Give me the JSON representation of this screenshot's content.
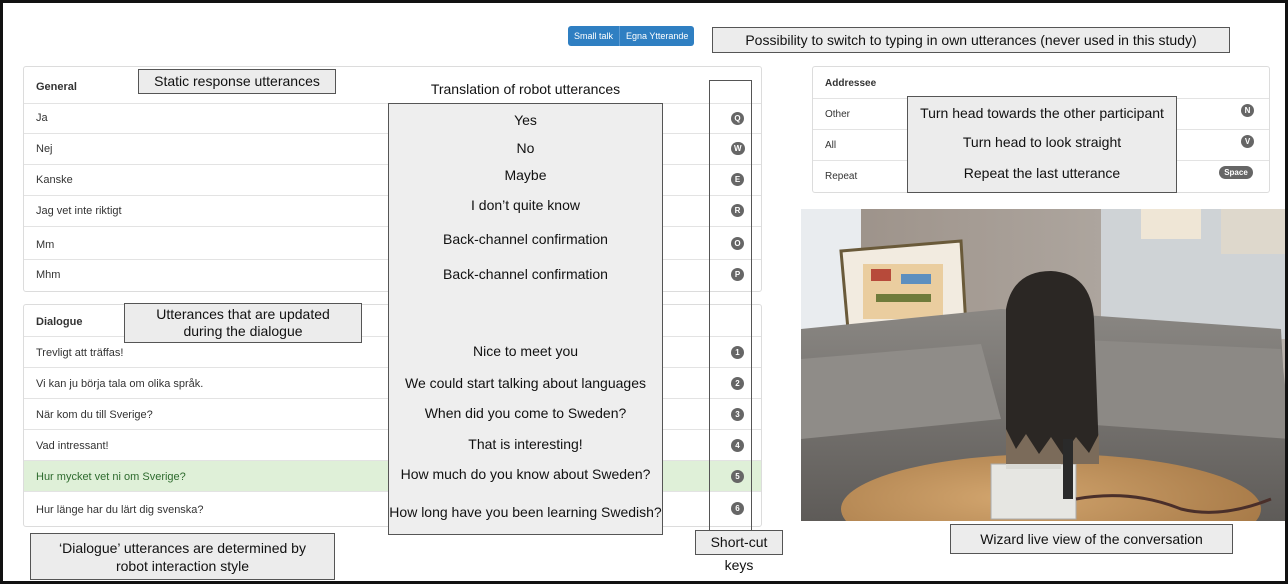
{
  "mode_buttons": {
    "small_talk": "Small talk",
    "own_utterances": "Egna Ytterande"
  },
  "general": {
    "header": "General",
    "rows": [
      {
        "label": "Ja",
        "key": "Q"
      },
      {
        "label": "Nej",
        "key": "W"
      },
      {
        "label": "Kanske",
        "key": "E"
      },
      {
        "label": "Jag vet inte riktigt",
        "key": "R"
      },
      {
        "label": "Mm",
        "key": "O"
      },
      {
        "label": "Mhm",
        "key": "P"
      }
    ]
  },
  "dialogue": {
    "header": "Dialogue",
    "rows": [
      {
        "label": "Trevligt att träffas!",
        "key": "1",
        "highlighted": false
      },
      {
        "label": "Vi kan ju börja tala om olika språk.",
        "key": "2",
        "highlighted": false
      },
      {
        "label": "När kom du till Sverige?",
        "key": "3",
        "highlighted": false
      },
      {
        "label": "Vad intressant!",
        "key": "4",
        "highlighted": false
      },
      {
        "label": "Hur mycket vet ni om Sverige?",
        "key": "5",
        "highlighted": true
      },
      {
        "label": "Hur länge har du lärt dig svenska?",
        "key": "6",
        "highlighted": false
      }
    ]
  },
  "addressee": {
    "header": "Addressee",
    "rows": [
      {
        "label": "Other",
        "key": "N"
      },
      {
        "label": "All",
        "key": "V"
      },
      {
        "label": "Repeat",
        "key": "Space"
      }
    ]
  },
  "annotations": {
    "switch_typing": "Possibility to switch to typing in own utterances (never used in this study)",
    "static_response": "Static response utterances",
    "translation_title": "Translation of robot utterances",
    "translations_general": [
      "Yes",
      "No",
      "Maybe",
      "I don’t quite know",
      "Back-channel confirmation",
      "Back-channel confirmation"
    ],
    "translations_dialogue": [
      "Nice to meet you",
      "We could start talking about languages",
      "When did you come to Sweden?",
      "That is interesting!",
      "How much do you know about Sweden?",
      "How long have you been learning Swedish?"
    ],
    "updated_line1": "Utterances that are updated",
    "updated_line2": "during the dialogue",
    "dialogue_style_line1": "‘Dialogue’ utterances are determined by",
    "dialogue_style_line2": "robot interaction style",
    "shortcut_keys": "Short-cut keys",
    "addressee_notes": [
      "Turn head towards the other participant",
      "Turn head to look straight",
      "Repeat the last utterance"
    ],
    "wizard_view": "Wizard live view of the conversation"
  },
  "colors": {
    "mode_button": "#2f7fc2",
    "highlight_row": "#dff0d8",
    "key_badge": "#666666",
    "callout_bg": "#ececec"
  }
}
